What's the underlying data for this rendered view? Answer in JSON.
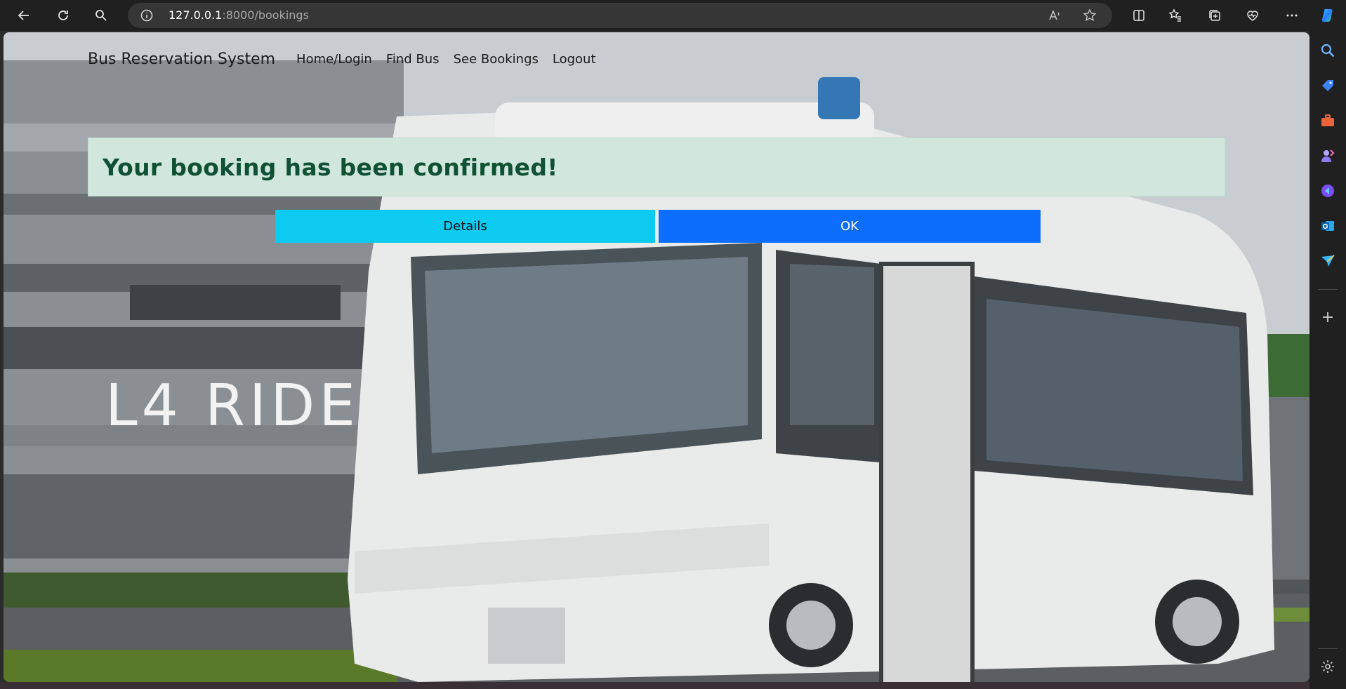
{
  "browser": {
    "url_host": "127.0.0.1",
    "url_rest": ":8000/bookings",
    "icons": [
      "back-icon",
      "refresh-icon",
      "search-icon",
      "info-icon",
      "read-aloud-icon",
      "favorite-star-icon",
      "split-screen-icon",
      "favorites-icon",
      "collections-icon",
      "browser-essentials-icon",
      "more-icon",
      "copilot-icon"
    ]
  },
  "edge_sidebar": {
    "icons": [
      "search-icon",
      "shopping-tag-icon",
      "tools-briefcase-icon",
      "games-icon",
      "office-icon",
      "outlook-icon",
      "send-icon",
      "add-icon",
      "settings-icon"
    ]
  },
  "nav": {
    "brand": "Bus Reservation System",
    "links": [
      "Home/Login",
      "Find Bus",
      "See Bookings",
      "Logout"
    ]
  },
  "alert": {
    "message": "Your booking has been confirmed!"
  },
  "buttons": {
    "details": "Details",
    "ok": "OK"
  },
  "background": {
    "logo_text": "L4 RIDE"
  },
  "colors": {
    "alert_bg": "#d1e7dd",
    "alert_text": "#0f5132",
    "details_btn": "#0dcaf0",
    "ok_btn": "#0d6efd"
  }
}
